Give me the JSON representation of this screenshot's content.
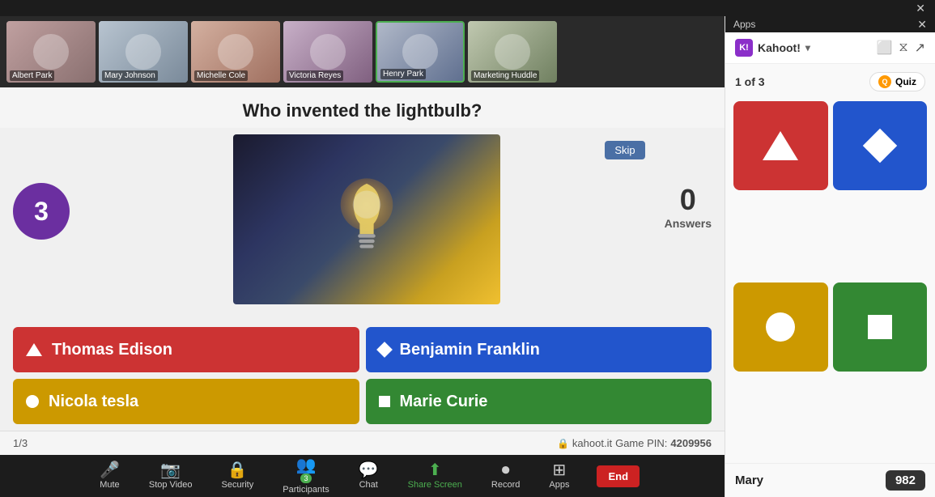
{
  "topbar": {
    "apps_title": "Apps",
    "close_label": "✕"
  },
  "video_strip": {
    "participants": [
      {
        "name": "Albert Park",
        "bg_class": "vt1"
      },
      {
        "name": "Mary Johnson",
        "bg_class": "vt2"
      },
      {
        "name": "Michelle Cole",
        "bg_class": "vt3"
      },
      {
        "name": "Victoria Reyes",
        "bg_class": "vt4"
      },
      {
        "name": "Henry Park",
        "bg_class": "vt5",
        "active": true
      },
      {
        "name": "Marketing Huddle",
        "bg_class": "vt6"
      }
    ]
  },
  "question": {
    "text": "Who invented the lightbulb?"
  },
  "timer": {
    "value": "3"
  },
  "skip_button": {
    "label": "Skip"
  },
  "answers": {
    "count": "0",
    "label": "Answers",
    "options": [
      {
        "text": "Thomas Edison",
        "color": "red",
        "shape": "triangle"
      },
      {
        "text": "Benjamin Franklin",
        "color": "blue",
        "shape": "diamond"
      },
      {
        "text": "Nicola tesla",
        "color": "yellow",
        "shape": "circle"
      },
      {
        "text": "Marie Curie",
        "color": "green",
        "shape": "square"
      }
    ]
  },
  "status_bar": {
    "progress": "1/3",
    "site": "kahoot.it",
    "game_pin_label": "Game PIN:",
    "game_pin": "4209956"
  },
  "toolbar": {
    "items": [
      {
        "id": "mute",
        "icon": "🎤",
        "label": "Mute"
      },
      {
        "id": "stop-video",
        "icon": "📷",
        "label": "Stop Video"
      },
      {
        "id": "security",
        "icon": "🔒",
        "label": "Security"
      },
      {
        "id": "participants",
        "icon": "👥",
        "label": "Participants",
        "badge": "3"
      },
      {
        "id": "chat",
        "icon": "💬",
        "label": "Chat"
      },
      {
        "id": "share-screen",
        "icon": "⬆",
        "label": "Share Screen",
        "active": true
      },
      {
        "id": "record",
        "icon": "⏺",
        "label": "Record"
      },
      {
        "id": "apps",
        "icon": "⊞",
        "label": "Apps"
      }
    ],
    "end_label": "End"
  },
  "kahoot": {
    "brand_name": "Kahoot!",
    "progress": "1 of 3",
    "quiz_label": "Quiz",
    "participant": {
      "name": "Mary",
      "score": "982"
    },
    "shapes": [
      {
        "type": "triangle",
        "color": "red-card"
      },
      {
        "type": "diamond",
        "color": "blue-card"
      },
      {
        "type": "circle",
        "color": "yellow-card"
      },
      {
        "type": "square",
        "color": "green-card"
      }
    ]
  }
}
